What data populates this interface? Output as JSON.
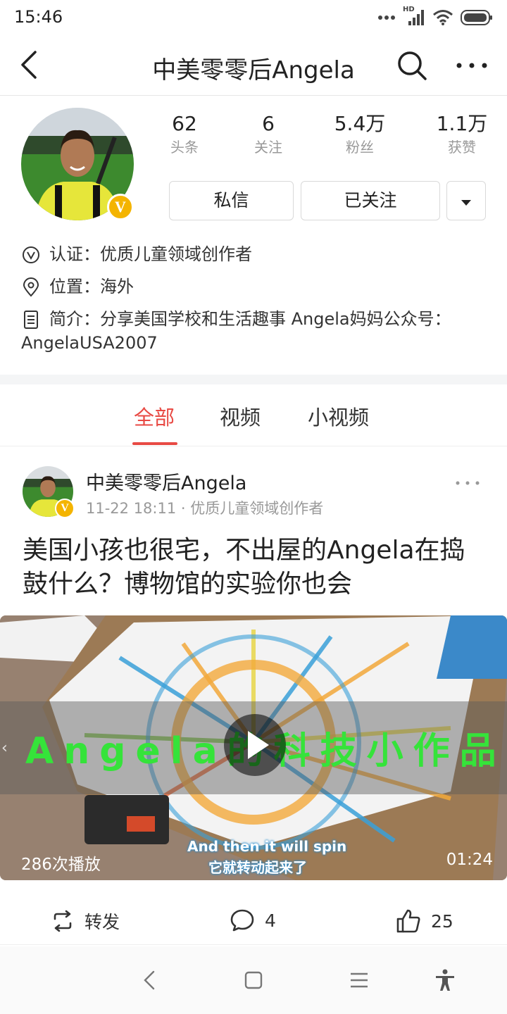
{
  "status_bar": {
    "time": "15:46",
    "network": "HD"
  },
  "nav": {
    "title": "中美零零后Angela"
  },
  "profile": {
    "badge": "V",
    "stats": [
      {
        "value": "62",
        "label": "头条"
      },
      {
        "value": "6",
        "label": "关注"
      },
      {
        "value": "5.4万",
        "label": "粉丝"
      },
      {
        "value": "1.1万",
        "label": "获赞"
      }
    ],
    "message_button": "私信",
    "follow_button": "已关注",
    "verify": "认证：优质儿童领域创作者",
    "location": "位置：海外",
    "bio_line1": "简介：分享美国学校和生活趣事 Angela妈妈公众号：",
    "bio_line2": "AngelaUSA2007"
  },
  "tabs": [
    "全部",
    "视频",
    "小视频"
  ],
  "post": {
    "author": "中美零零后Angela",
    "badge": "V",
    "meta": "11-22 18:11 · 优质儿童领域创作者",
    "title": "美国小孩也很宅，不出屋的Angela在捣鼓什么？博物馆的实验你也会",
    "video": {
      "overlay_title": "Angela的科技小作品",
      "views": "286次播放",
      "duration": "01:24",
      "subtitle_en": "And then it will spin",
      "subtitle_zh": "它就转动起来了"
    },
    "actions": {
      "share": "转发",
      "comments": "4",
      "likes": "25"
    }
  },
  "colors": {
    "accent": "#e84a44",
    "badge": "#f4b400",
    "overlay_text": "#35e33a"
  }
}
